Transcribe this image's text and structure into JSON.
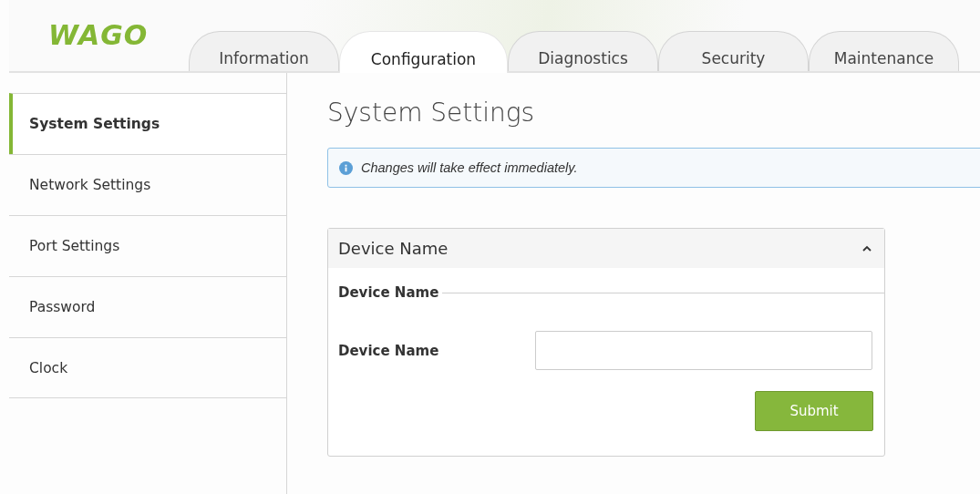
{
  "logo": {
    "text": "WAGO"
  },
  "tabs": [
    {
      "label": "Information",
      "selected": false
    },
    {
      "label": "Configuration",
      "selected": true
    },
    {
      "label": "Diagnostics",
      "selected": false
    },
    {
      "label": "Security",
      "selected": false
    },
    {
      "label": "Maintenance",
      "selected": false
    }
  ],
  "sidebar": {
    "items": [
      {
        "label": "System Settings",
        "selected": true
      },
      {
        "label": "Network Settings",
        "selected": false
      },
      {
        "label": "Port Settings",
        "selected": false
      },
      {
        "label": "Password",
        "selected": false
      },
      {
        "label": "Clock",
        "selected": false
      }
    ]
  },
  "page_title": "System Settings",
  "info_message": "Changes will take effect immediately.",
  "panel": {
    "title": "Device Name",
    "expanded": true,
    "legend": "Device Name",
    "field_label": "Device Name",
    "submit": "Submit"
  }
}
